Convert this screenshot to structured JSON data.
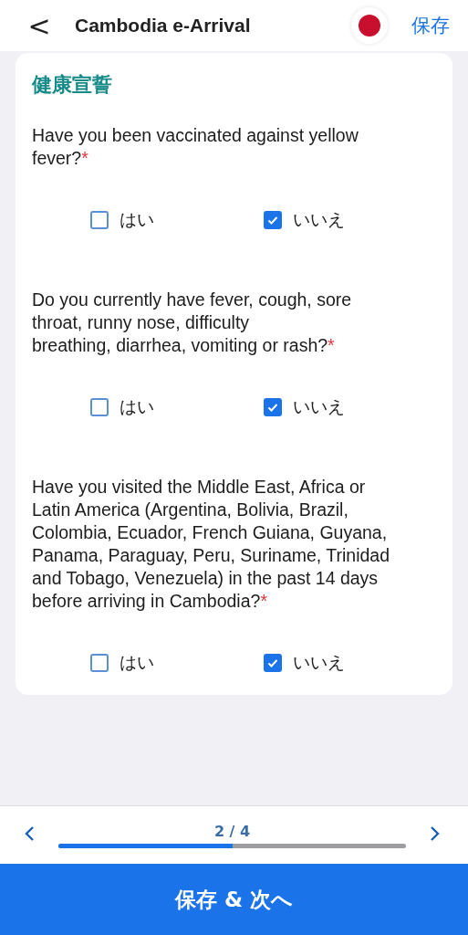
{
  "header": {
    "back": "<",
    "title": "Cambodia e-Arrival",
    "save": "保存"
  },
  "section": {
    "title": "健康宣誓"
  },
  "questions": [
    {
      "text": "Have you been vaccinated against yellow fever?",
      "required_mark": "*",
      "options": [
        {
          "label": "はい",
          "checked": false
        },
        {
          "label": "いいえ",
          "checked": true
        }
      ]
    },
    {
      "text": "Do you currently have fever, cough,  sore throat, runny nose, difficulty\nbreathing, diarrhea, vomiting or rash?",
      "required_mark": "*",
      "options": [
        {
          "label": "はい",
          "checked": false
        },
        {
          "label": "いいえ",
          "checked": true
        }
      ]
    },
    {
      "text": "Have you visited the Middle East, Africa or Latin America (Argentina, Bolivia, Brazil, Colombia, Ecuador, French Guiana, Guyana, Panama, Paraguay, Peru, Suriname, Trinidad and Tobago, Venezuela) in the past 14 days before arriving in Cambodia?",
      "required_mark": "*",
      "options": [
        {
          "label": "はい",
          "checked": false
        },
        {
          "label": "いいえ",
          "checked": true
        }
      ]
    }
  ],
  "pager": {
    "label": "2 / 4",
    "level": 0.5
  },
  "primary_button": "保存 & 次へ"
}
